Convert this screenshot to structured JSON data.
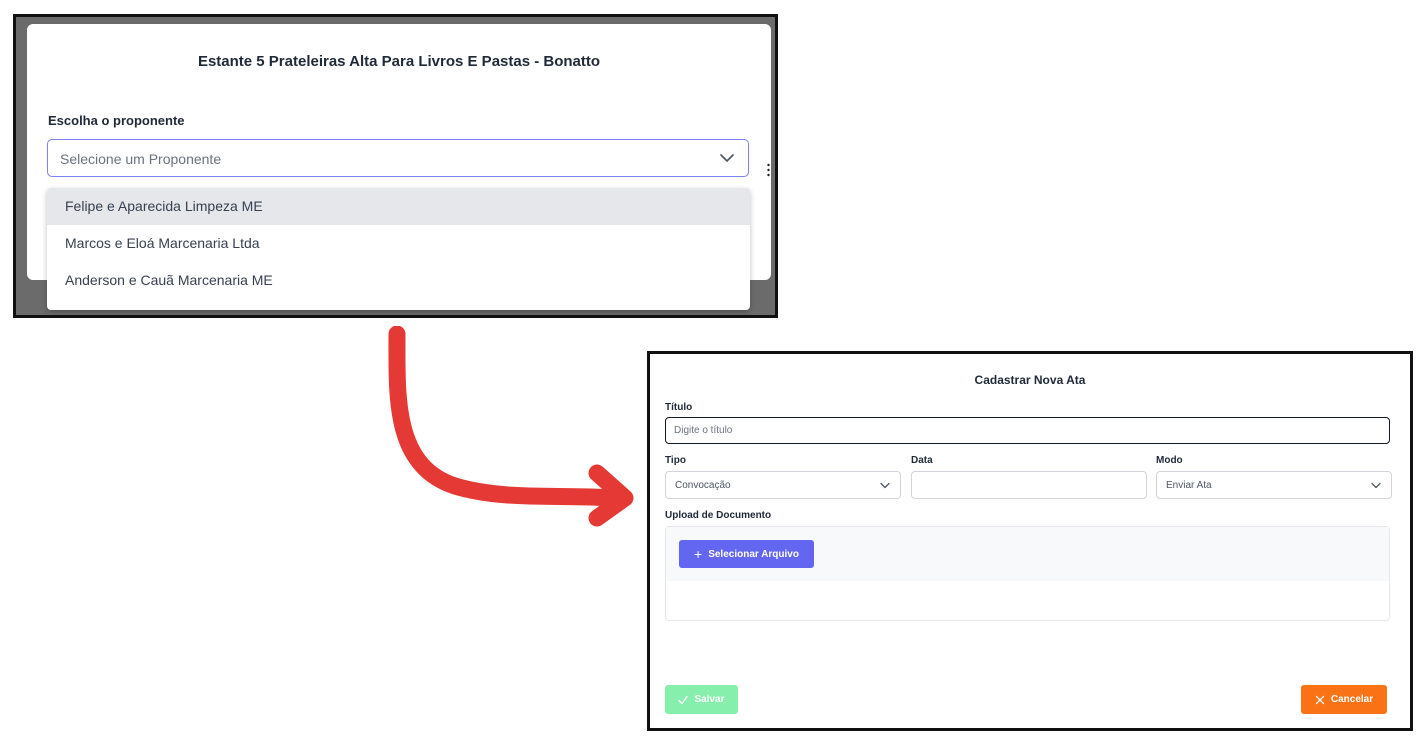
{
  "proponent_modal": {
    "title": "Estante 5 Prateleiras Alta Para Livros E Pastas - Bonatto",
    "label": "Escolha o proponente",
    "select_placeholder": "Selecione um Proponente",
    "options": [
      {
        "label": "Felipe e Aparecida Limpeza ME",
        "highlighted": true
      },
      {
        "label": "Marcos e Eloá Marcenaria Ltda",
        "highlighted": false
      },
      {
        "label": "Anderson e Cauã Marcenaria ME",
        "highlighted": false
      }
    ]
  },
  "arrow": {
    "color": "#e53935",
    "icon": "curved-arrow-icon"
  },
  "ata_modal": {
    "title": "Cadastrar Nova Ata",
    "titulo_label": "Título",
    "titulo_placeholder": "Digite o título",
    "tipo_label": "Tipo",
    "tipo_value": "Convocação",
    "data_label": "Data",
    "data_value": "",
    "modo_label": "Modo",
    "modo_value": "Enviar Ata",
    "upload_label": "Upload de Documento",
    "select_file_label": "Selecionar Arquivo",
    "save_label": "Salvar",
    "cancel_label": "Cancelar"
  },
  "colors": {
    "primary": "#6366f1",
    "save": "#86efac",
    "cancel": "#f97316",
    "focus_border": "#7c83f0"
  }
}
